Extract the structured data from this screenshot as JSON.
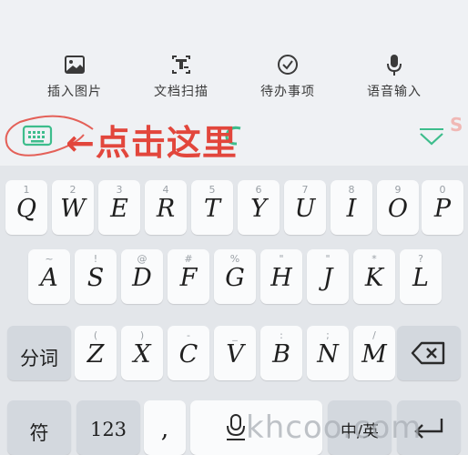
{
  "toolbar": {
    "items": [
      {
        "label": "插入图片",
        "icon": "image-icon"
      },
      {
        "label": "文档扫描",
        "icon": "document-scan-icon"
      },
      {
        "label": "待办事项",
        "icon": "check-circle-icon"
      },
      {
        "label": "语音输入",
        "icon": "microphone-icon"
      }
    ]
  },
  "candidate_bar": {
    "callout_text": "←点击这里",
    "keyboard_toggle_icon": "keyboard-icon",
    "collapse_icon": "chevron-down-icon",
    "accent_color": "#3dbd8c",
    "callout_color": "#e2463c",
    "corner_glyph": "S"
  },
  "keyboard": {
    "row1": [
      {
        "hint": "1",
        "key": "Q"
      },
      {
        "hint": "2",
        "key": "W"
      },
      {
        "hint": "3",
        "key": "E"
      },
      {
        "hint": "4",
        "key": "R"
      },
      {
        "hint": "5",
        "key": "T"
      },
      {
        "hint": "6",
        "key": "Y"
      },
      {
        "hint": "7",
        "key": "U"
      },
      {
        "hint": "8",
        "key": "I"
      },
      {
        "hint": "9",
        "key": "O"
      },
      {
        "hint": "0",
        "key": "P"
      }
    ],
    "row2": [
      {
        "hint": "~",
        "key": "A"
      },
      {
        "hint": "!",
        "key": "S"
      },
      {
        "hint": "@",
        "key": "D"
      },
      {
        "hint": "#",
        "key": "F"
      },
      {
        "hint": "%",
        "key": "G"
      },
      {
        "hint": "\"",
        "key": "H"
      },
      {
        "hint": "\"",
        "key": "J"
      },
      {
        "hint": "*",
        "key": "K"
      },
      {
        "hint": "?",
        "key": "L"
      }
    ],
    "row3": [
      {
        "hint": "(",
        "key": "Z"
      },
      {
        "hint": ")",
        "key": "X"
      },
      {
        "hint": "-",
        "key": "C"
      },
      {
        "hint": "_",
        "key": "V"
      },
      {
        "hint": ":",
        "key": "B"
      },
      {
        "hint": ";",
        "key": "N"
      },
      {
        "hint": "/",
        "key": "M"
      }
    ],
    "fenci_label": "分词",
    "backspace_icon": "backspace-icon",
    "symbol_label": "符",
    "num_label": "123",
    "comma_label": ",",
    "space_icon": "microphone-icon",
    "lang_label": "中/英",
    "enter_icon": "enter-icon"
  },
  "watermark": "khcoo.com"
}
